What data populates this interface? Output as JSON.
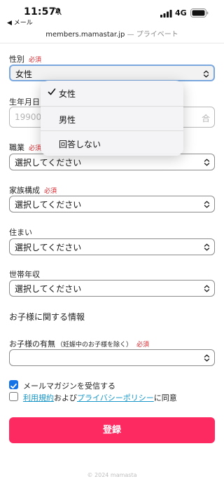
{
  "status_bar": {
    "time": "11:57",
    "back_label": "◀ メール",
    "network": "4G",
    "icons": [
      "bell-muted-icon",
      "signal-icon",
      "battery-icon"
    ]
  },
  "url_bar": {
    "host": "members.mamastar.jp",
    "suffix": " — プライベート"
  },
  "form": {
    "required_mark": "必須",
    "gender": {
      "label": "性別",
      "value": "女性"
    },
    "birthdate": {
      "label": "生年月日",
      "placeholder": "19900",
      "placeholder_suffix": "合"
    },
    "occupation": {
      "label": "職業",
      "value": "選択してください"
    },
    "family": {
      "label": "家族構成",
      "value": "選択してください"
    },
    "residence": {
      "label": "住まい",
      "value": "選択してください"
    },
    "income": {
      "label": "世帯年収",
      "value": "選択してください"
    },
    "children_section_title": "お子様に関する情報",
    "children": {
      "label": "お子様の有無",
      "note": "（妊娠中のお子様を除く）",
      "value": ""
    },
    "newsletter": {
      "label": "メールマガジンを受信する",
      "checked": true
    },
    "agreement": {
      "checked": false,
      "terms_link": "利用規約",
      "joiner": "および",
      "privacy_link": "プライバシーポリシー",
      "suffix": "に同意"
    },
    "submit_label": "登録"
  },
  "dropdown": {
    "options": [
      "女性",
      "男性",
      "回答しない"
    ],
    "selected": "女性"
  },
  "footer": "© 2024 mamasta",
  "colors": {
    "accent": "#fd2a62",
    "required": "#d6252b",
    "link": "#1a98c9",
    "checkbox": "#1473e6"
  }
}
